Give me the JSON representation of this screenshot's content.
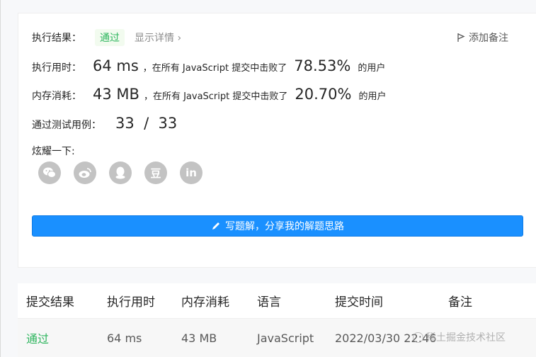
{
  "result": {
    "label": "执行结果：",
    "status": "通过",
    "details_link": "显示详情 ›",
    "add_note": "添加备注"
  },
  "runtime": {
    "label": "执行用时：",
    "value": "64 ms",
    "prefix": "，在所有 JavaScript 提交中击败了",
    "percent": "78.53%",
    "suffix": "的用户"
  },
  "memory": {
    "label": "内存消耗：",
    "value": "43 MB",
    "prefix": "，在所有 JavaScript 提交中击败了",
    "percent": "20.70%",
    "suffix": "的用户"
  },
  "tests": {
    "label": "通过测试用例：",
    "value": "33  /  33"
  },
  "share": {
    "label": "炫耀一下:",
    "icons": [
      "wechat-icon",
      "weibo-icon",
      "qq-icon",
      "douban-icon",
      "linkedin-icon"
    ],
    "douban_glyph": "豆",
    "linkedin_glyph": "in"
  },
  "solution_button": "写题解，分享我的解题思路",
  "table": {
    "headers": [
      "提交结果",
      "执行用时",
      "内存消耗",
      "语言",
      "提交时间",
      "备注"
    ],
    "row": {
      "status": "通过",
      "runtime": "64 ms",
      "memory": "43 MB",
      "language": "JavaScript",
      "time": "2022/03/30 22:46"
    }
  },
  "watermark": "稀土掘金技术社区",
  "colors": {
    "accent": "#1a90ff",
    "success": "#2db55d",
    "icon_gray": "#c3c3c3"
  }
}
